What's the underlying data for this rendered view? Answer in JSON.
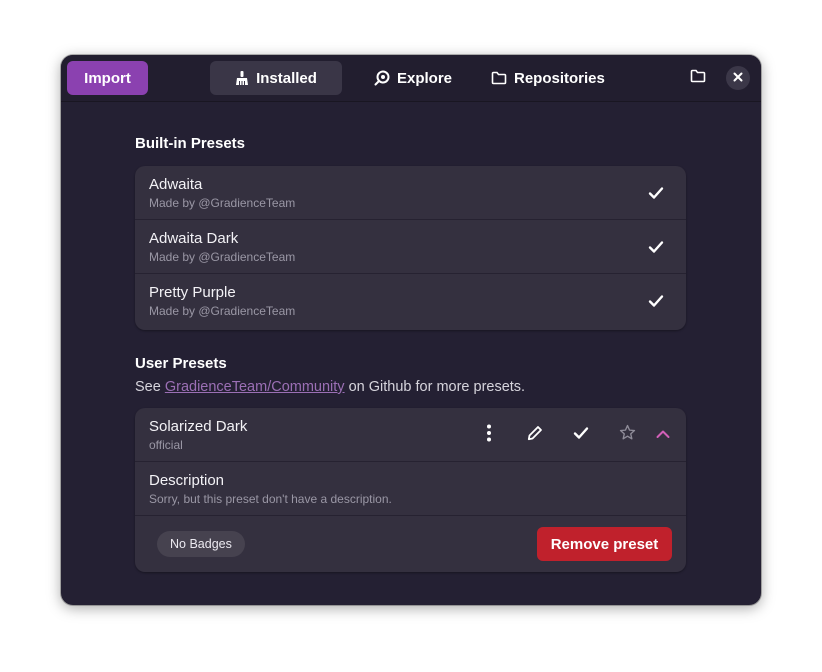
{
  "header": {
    "import_label": "Import",
    "tabs": [
      {
        "label": "Installed",
        "icon": "broom-icon",
        "active": true
      },
      {
        "label": "Explore",
        "icon": "explore-icon",
        "active": false
      },
      {
        "label": "Repositories",
        "icon": "folder-icon",
        "active": false
      }
    ],
    "folder_icon": "folder-icon",
    "close_icon": "close-icon"
  },
  "builtin": {
    "title": "Built-in Presets",
    "presets": [
      {
        "name": "Adwaita",
        "author": "Made by @GradienceTeam"
      },
      {
        "name": "Adwaita Dark",
        "author": "Made by @GradienceTeam"
      },
      {
        "name": "Pretty Purple",
        "author": "Made by @GradienceTeam"
      }
    ]
  },
  "user": {
    "title": "User Presets",
    "subtitle_prefix": "See ",
    "subtitle_link": "GradienceTeam/Community",
    "subtitle_suffix": " on Github for more presets.",
    "preset": {
      "name": "Solarized Dark",
      "source": "official",
      "description_title": "Description",
      "description_text": "Sorry, but this preset don't have a description.",
      "badge": "No Badges",
      "remove_label": "Remove preset"
    }
  },
  "colors": {
    "accent": "#8b41b0",
    "destructive": "#c0212c",
    "link": "#9b6fb5",
    "expander": "#d15fb7"
  }
}
